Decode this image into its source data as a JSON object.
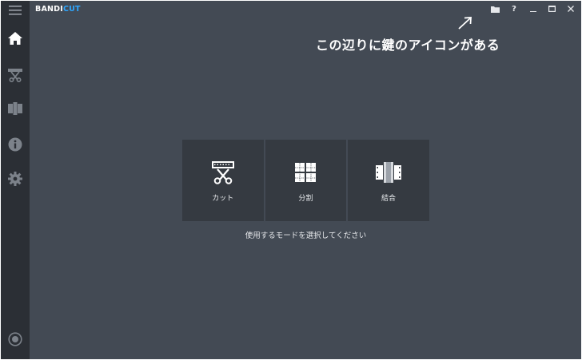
{
  "app": {
    "brand_part1": "BANDI",
    "brand_part2": "CUT",
    "accent_color": "#2ea7ff"
  },
  "titlebar": {
    "icons": [
      "folder-icon",
      "help-icon",
      "minimize-icon",
      "maximize-icon",
      "close-icon"
    ],
    "help_label": "?"
  },
  "sidebar": {
    "items": [
      {
        "name": "menu",
        "icon": "hamburger-icon"
      },
      {
        "name": "home",
        "icon": "home-icon"
      },
      {
        "name": "cut",
        "icon": "scissors-icon"
      },
      {
        "name": "merge",
        "icon": "film-merge-icon"
      },
      {
        "name": "info",
        "icon": "info-icon"
      },
      {
        "name": "settings",
        "icon": "gear-icon"
      },
      {
        "name": "record",
        "icon": "record-icon"
      }
    ]
  },
  "annotation": {
    "text": "この辺りに鍵のアイコンがある"
  },
  "modes": [
    {
      "label": "カット",
      "icon": "cut-mode-icon"
    },
    {
      "label": "分割",
      "icon": "split-mode-icon"
    },
    {
      "label": "結合",
      "icon": "join-mode-icon"
    }
  ],
  "hint": "使用するモードを選択してください"
}
